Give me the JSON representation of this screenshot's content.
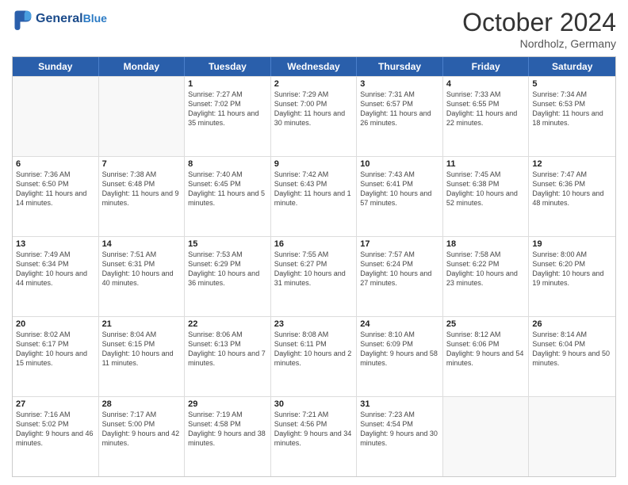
{
  "header": {
    "logo_line1": "General",
    "logo_line2": "Blue",
    "month_title": "October 2024",
    "location": "Nordholz, Germany"
  },
  "weekdays": [
    "Sunday",
    "Monday",
    "Tuesday",
    "Wednesday",
    "Thursday",
    "Friday",
    "Saturday"
  ],
  "rows": [
    [
      {
        "day": "",
        "info": ""
      },
      {
        "day": "",
        "info": ""
      },
      {
        "day": "1",
        "info": "Sunrise: 7:27 AM\nSunset: 7:02 PM\nDaylight: 11 hours and 35 minutes."
      },
      {
        "day": "2",
        "info": "Sunrise: 7:29 AM\nSunset: 7:00 PM\nDaylight: 11 hours and 30 minutes."
      },
      {
        "day": "3",
        "info": "Sunrise: 7:31 AM\nSunset: 6:57 PM\nDaylight: 11 hours and 26 minutes."
      },
      {
        "day": "4",
        "info": "Sunrise: 7:33 AM\nSunset: 6:55 PM\nDaylight: 11 hours and 22 minutes."
      },
      {
        "day": "5",
        "info": "Sunrise: 7:34 AM\nSunset: 6:53 PM\nDaylight: 11 hours and 18 minutes."
      }
    ],
    [
      {
        "day": "6",
        "info": "Sunrise: 7:36 AM\nSunset: 6:50 PM\nDaylight: 11 hours and 14 minutes."
      },
      {
        "day": "7",
        "info": "Sunrise: 7:38 AM\nSunset: 6:48 PM\nDaylight: 11 hours and 9 minutes."
      },
      {
        "day": "8",
        "info": "Sunrise: 7:40 AM\nSunset: 6:45 PM\nDaylight: 11 hours and 5 minutes."
      },
      {
        "day": "9",
        "info": "Sunrise: 7:42 AM\nSunset: 6:43 PM\nDaylight: 11 hours and 1 minute."
      },
      {
        "day": "10",
        "info": "Sunrise: 7:43 AM\nSunset: 6:41 PM\nDaylight: 10 hours and 57 minutes."
      },
      {
        "day": "11",
        "info": "Sunrise: 7:45 AM\nSunset: 6:38 PM\nDaylight: 10 hours and 52 minutes."
      },
      {
        "day": "12",
        "info": "Sunrise: 7:47 AM\nSunset: 6:36 PM\nDaylight: 10 hours and 48 minutes."
      }
    ],
    [
      {
        "day": "13",
        "info": "Sunrise: 7:49 AM\nSunset: 6:34 PM\nDaylight: 10 hours and 44 minutes."
      },
      {
        "day": "14",
        "info": "Sunrise: 7:51 AM\nSunset: 6:31 PM\nDaylight: 10 hours and 40 minutes."
      },
      {
        "day": "15",
        "info": "Sunrise: 7:53 AM\nSunset: 6:29 PM\nDaylight: 10 hours and 36 minutes."
      },
      {
        "day": "16",
        "info": "Sunrise: 7:55 AM\nSunset: 6:27 PM\nDaylight: 10 hours and 31 minutes."
      },
      {
        "day": "17",
        "info": "Sunrise: 7:57 AM\nSunset: 6:24 PM\nDaylight: 10 hours and 27 minutes."
      },
      {
        "day": "18",
        "info": "Sunrise: 7:58 AM\nSunset: 6:22 PM\nDaylight: 10 hours and 23 minutes."
      },
      {
        "day": "19",
        "info": "Sunrise: 8:00 AM\nSunset: 6:20 PM\nDaylight: 10 hours and 19 minutes."
      }
    ],
    [
      {
        "day": "20",
        "info": "Sunrise: 8:02 AM\nSunset: 6:17 PM\nDaylight: 10 hours and 15 minutes."
      },
      {
        "day": "21",
        "info": "Sunrise: 8:04 AM\nSunset: 6:15 PM\nDaylight: 10 hours and 11 minutes."
      },
      {
        "day": "22",
        "info": "Sunrise: 8:06 AM\nSunset: 6:13 PM\nDaylight: 10 hours and 7 minutes."
      },
      {
        "day": "23",
        "info": "Sunrise: 8:08 AM\nSunset: 6:11 PM\nDaylight: 10 hours and 2 minutes."
      },
      {
        "day": "24",
        "info": "Sunrise: 8:10 AM\nSunset: 6:09 PM\nDaylight: 9 hours and 58 minutes."
      },
      {
        "day": "25",
        "info": "Sunrise: 8:12 AM\nSunset: 6:06 PM\nDaylight: 9 hours and 54 minutes."
      },
      {
        "day": "26",
        "info": "Sunrise: 8:14 AM\nSunset: 6:04 PM\nDaylight: 9 hours and 50 minutes."
      }
    ],
    [
      {
        "day": "27",
        "info": "Sunrise: 7:16 AM\nSunset: 5:02 PM\nDaylight: 9 hours and 46 minutes."
      },
      {
        "day": "28",
        "info": "Sunrise: 7:17 AM\nSunset: 5:00 PM\nDaylight: 9 hours and 42 minutes."
      },
      {
        "day": "29",
        "info": "Sunrise: 7:19 AM\nSunset: 4:58 PM\nDaylight: 9 hours and 38 minutes."
      },
      {
        "day": "30",
        "info": "Sunrise: 7:21 AM\nSunset: 4:56 PM\nDaylight: 9 hours and 34 minutes."
      },
      {
        "day": "31",
        "info": "Sunrise: 7:23 AM\nSunset: 4:54 PM\nDaylight: 9 hours and 30 minutes."
      },
      {
        "day": "",
        "info": ""
      },
      {
        "day": "",
        "info": ""
      }
    ]
  ]
}
